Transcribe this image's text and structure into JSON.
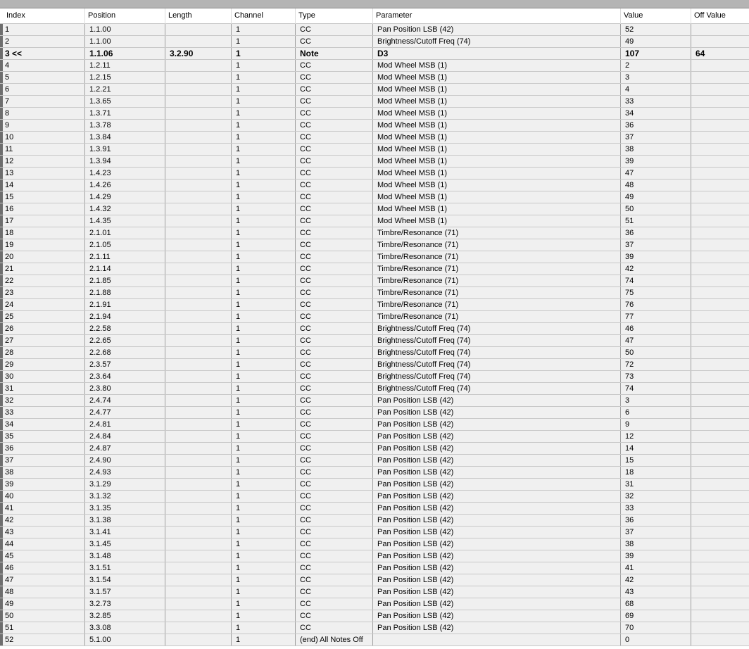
{
  "columns": [
    "Index",
    "Position",
    "Length",
    "Channel",
    "Type",
    "Parameter",
    "Value",
    "Off Value"
  ],
  "rows": [
    {
      "index": "1",
      "position": "1.1.00",
      "length": "",
      "channel": "1",
      "type": "CC",
      "parameter": "Pan Position LSB (42)",
      "value": "52",
      "off_value": ""
    },
    {
      "index": "2",
      "position": "1.1.00",
      "length": "",
      "channel": "1",
      "type": "CC",
      "parameter": "Brightness/Cutoff Freq (74)",
      "value": "49",
      "off_value": ""
    },
    {
      "index": "3 <<",
      "position": "1.1.06",
      "length": "3.2.90",
      "channel": "1",
      "type": "Note",
      "parameter": "D3",
      "value": "107",
      "off_value": "64",
      "selected": true
    },
    {
      "index": "4",
      "position": "1.2.11",
      "length": "",
      "channel": "1",
      "type": "CC",
      "parameter": "Mod Wheel MSB (1)",
      "value": "2",
      "off_value": ""
    },
    {
      "index": "5",
      "position": "1.2.15",
      "length": "",
      "channel": "1",
      "type": "CC",
      "parameter": "Mod Wheel MSB (1)",
      "value": "3",
      "off_value": ""
    },
    {
      "index": "6",
      "position": "1.2.21",
      "length": "",
      "channel": "1",
      "type": "CC",
      "parameter": "Mod Wheel MSB (1)",
      "value": "4",
      "off_value": ""
    },
    {
      "index": "7",
      "position": "1.3.65",
      "length": "",
      "channel": "1",
      "type": "CC",
      "parameter": "Mod Wheel MSB (1)",
      "value": "33",
      "off_value": ""
    },
    {
      "index": "8",
      "position": "1.3.71",
      "length": "",
      "channel": "1",
      "type": "CC",
      "parameter": "Mod Wheel MSB (1)",
      "value": "34",
      "off_value": ""
    },
    {
      "index": "9",
      "position": "1.3.78",
      "length": "",
      "channel": "1",
      "type": "CC",
      "parameter": "Mod Wheel MSB (1)",
      "value": "36",
      "off_value": ""
    },
    {
      "index": "10",
      "position": "1.3.84",
      "length": "",
      "channel": "1",
      "type": "CC",
      "parameter": "Mod Wheel MSB (1)",
      "value": "37",
      "off_value": ""
    },
    {
      "index": "11",
      "position": "1.3.91",
      "length": "",
      "channel": "1",
      "type": "CC",
      "parameter": "Mod Wheel MSB (1)",
      "value": "38",
      "off_value": ""
    },
    {
      "index": "12",
      "position": "1.3.94",
      "length": "",
      "channel": "1",
      "type": "CC",
      "parameter": "Mod Wheel MSB (1)",
      "value": "39",
      "off_value": ""
    },
    {
      "index": "13",
      "position": "1.4.23",
      "length": "",
      "channel": "1",
      "type": "CC",
      "parameter": "Mod Wheel MSB (1)",
      "value": "47",
      "off_value": ""
    },
    {
      "index": "14",
      "position": "1.4.26",
      "length": "",
      "channel": "1",
      "type": "CC",
      "parameter": "Mod Wheel MSB (1)",
      "value": "48",
      "off_value": ""
    },
    {
      "index": "15",
      "position": "1.4.29",
      "length": "",
      "channel": "1",
      "type": "CC",
      "parameter": "Mod Wheel MSB (1)",
      "value": "49",
      "off_value": ""
    },
    {
      "index": "16",
      "position": "1.4.32",
      "length": "",
      "channel": "1",
      "type": "CC",
      "parameter": "Mod Wheel MSB (1)",
      "value": "50",
      "off_value": ""
    },
    {
      "index": "17",
      "position": "1.4.35",
      "length": "",
      "channel": "1",
      "type": "CC",
      "parameter": "Mod Wheel MSB (1)",
      "value": "51",
      "off_value": ""
    },
    {
      "index": "18",
      "position": "2.1.01",
      "length": "",
      "channel": "1",
      "type": "CC",
      "parameter": "Timbre/Resonance (71)",
      "value": "36",
      "off_value": ""
    },
    {
      "index": "19",
      "position": "2.1.05",
      "length": "",
      "channel": "1",
      "type": "CC",
      "parameter": "Timbre/Resonance (71)",
      "value": "37",
      "off_value": ""
    },
    {
      "index": "20",
      "position": "2.1.11",
      "length": "",
      "channel": "1",
      "type": "CC",
      "parameter": "Timbre/Resonance (71)",
      "value": "39",
      "off_value": ""
    },
    {
      "index": "21",
      "position": "2.1.14",
      "length": "",
      "channel": "1",
      "type": "CC",
      "parameter": "Timbre/Resonance (71)",
      "value": "42",
      "off_value": ""
    },
    {
      "index": "22",
      "position": "2.1.85",
      "length": "",
      "channel": "1",
      "type": "CC",
      "parameter": "Timbre/Resonance (71)",
      "value": "74",
      "off_value": ""
    },
    {
      "index": "23",
      "position": "2.1.88",
      "length": "",
      "channel": "1",
      "type": "CC",
      "parameter": "Timbre/Resonance (71)",
      "value": "75",
      "off_value": ""
    },
    {
      "index": "24",
      "position": "2.1.91",
      "length": "",
      "channel": "1",
      "type": "CC",
      "parameter": "Timbre/Resonance (71)",
      "value": "76",
      "off_value": ""
    },
    {
      "index": "25",
      "position": "2.1.94",
      "length": "",
      "channel": "1",
      "type": "CC",
      "parameter": "Timbre/Resonance (71)",
      "value": "77",
      "off_value": ""
    },
    {
      "index": "26",
      "position": "2.2.58",
      "length": "",
      "channel": "1",
      "type": "CC",
      "parameter": "Brightness/Cutoff Freq (74)",
      "value": "46",
      "off_value": ""
    },
    {
      "index": "27",
      "position": "2.2.65",
      "length": "",
      "channel": "1",
      "type": "CC",
      "parameter": "Brightness/Cutoff Freq (74)",
      "value": "47",
      "off_value": ""
    },
    {
      "index": "28",
      "position": "2.2.68",
      "length": "",
      "channel": "1",
      "type": "CC",
      "parameter": "Brightness/Cutoff Freq (74)",
      "value": "50",
      "off_value": ""
    },
    {
      "index": "29",
      "position": "2.3.57",
      "length": "",
      "channel": "1",
      "type": "CC",
      "parameter": "Brightness/Cutoff Freq (74)",
      "value": "72",
      "off_value": ""
    },
    {
      "index": "30",
      "position": "2.3.64",
      "length": "",
      "channel": "1",
      "type": "CC",
      "parameter": "Brightness/Cutoff Freq (74)",
      "value": "73",
      "off_value": ""
    },
    {
      "index": "31",
      "position": "2.3.80",
      "length": "",
      "channel": "1",
      "type": "CC",
      "parameter": "Brightness/Cutoff Freq (74)",
      "value": "74",
      "off_value": ""
    },
    {
      "index": "32",
      "position": "2.4.74",
      "length": "",
      "channel": "1",
      "type": "CC",
      "parameter": "Pan Position LSB (42)",
      "value": "3",
      "off_value": ""
    },
    {
      "index": "33",
      "position": "2.4.77",
      "length": "",
      "channel": "1",
      "type": "CC",
      "parameter": "Pan Position LSB (42)",
      "value": "6",
      "off_value": ""
    },
    {
      "index": "34",
      "position": "2.4.81",
      "length": "",
      "channel": "1",
      "type": "CC",
      "parameter": "Pan Position LSB (42)",
      "value": "9",
      "off_value": ""
    },
    {
      "index": "35",
      "position": "2.4.84",
      "length": "",
      "channel": "1",
      "type": "CC",
      "parameter": "Pan Position LSB (42)",
      "value": "12",
      "off_value": ""
    },
    {
      "index": "36",
      "position": "2.4.87",
      "length": "",
      "channel": "1",
      "type": "CC",
      "parameter": "Pan Position LSB (42)",
      "value": "14",
      "off_value": ""
    },
    {
      "index": "37",
      "position": "2.4.90",
      "length": "",
      "channel": "1",
      "type": "CC",
      "parameter": "Pan Position LSB (42)",
      "value": "15",
      "off_value": ""
    },
    {
      "index": "38",
      "position": "2.4.93",
      "length": "",
      "channel": "1",
      "type": "CC",
      "parameter": "Pan Position LSB (42)",
      "value": "18",
      "off_value": ""
    },
    {
      "index": "39",
      "position": "3.1.29",
      "length": "",
      "channel": "1",
      "type": "CC",
      "parameter": "Pan Position LSB (42)",
      "value": "31",
      "off_value": ""
    },
    {
      "index": "40",
      "position": "3.1.32",
      "length": "",
      "channel": "1",
      "type": "CC",
      "parameter": "Pan Position LSB (42)",
      "value": "32",
      "off_value": ""
    },
    {
      "index": "41",
      "position": "3.1.35",
      "length": "",
      "channel": "1",
      "type": "CC",
      "parameter": "Pan Position LSB (42)",
      "value": "33",
      "off_value": ""
    },
    {
      "index": "42",
      "position": "3.1.38",
      "length": "",
      "channel": "1",
      "type": "CC",
      "parameter": "Pan Position LSB (42)",
      "value": "36",
      "off_value": ""
    },
    {
      "index": "43",
      "position": "3.1.41",
      "length": "",
      "channel": "1",
      "type": "CC",
      "parameter": "Pan Position LSB (42)",
      "value": "37",
      "off_value": ""
    },
    {
      "index": "44",
      "position": "3.1.45",
      "length": "",
      "channel": "1",
      "type": "CC",
      "parameter": "Pan Position LSB (42)",
      "value": "38",
      "off_value": ""
    },
    {
      "index": "45",
      "position": "3.1.48",
      "length": "",
      "channel": "1",
      "type": "CC",
      "parameter": "Pan Position LSB (42)",
      "value": "39",
      "off_value": ""
    },
    {
      "index": "46",
      "position": "3.1.51",
      "length": "",
      "channel": "1",
      "type": "CC",
      "parameter": "Pan Position LSB (42)",
      "value": "41",
      "off_value": ""
    },
    {
      "index": "47",
      "position": "3.1.54",
      "length": "",
      "channel": "1",
      "type": "CC",
      "parameter": "Pan Position LSB (42)",
      "value": "42",
      "off_value": ""
    },
    {
      "index": "48",
      "position": "3.1.57",
      "length": "",
      "channel": "1",
      "type": "CC",
      "parameter": "Pan Position LSB (42)",
      "value": "43",
      "off_value": ""
    },
    {
      "index": "49",
      "position": "3.2.73",
      "length": "",
      "channel": "1",
      "type": "CC",
      "parameter": "Pan Position LSB (42)",
      "value": "68",
      "off_value": ""
    },
    {
      "index": "50",
      "position": "3.2.85",
      "length": "",
      "channel": "1",
      "type": "CC",
      "parameter": "Pan Position LSB (42)",
      "value": "69",
      "off_value": ""
    },
    {
      "index": "51",
      "position": "3.3.08",
      "length": "",
      "channel": "1",
      "type": "CC",
      "parameter": "Pan Position LSB (42)",
      "value": "70",
      "off_value": ""
    },
    {
      "index": "52",
      "position": "5.1.00",
      "length": "",
      "channel": "1",
      "type": "(end) All Notes Off",
      "parameter": "",
      "value": "0",
      "off_value": ""
    }
  ]
}
